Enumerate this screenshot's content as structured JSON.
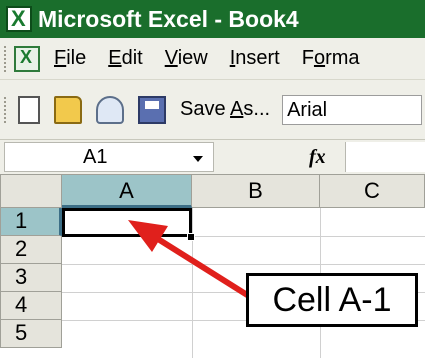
{
  "window": {
    "title": "Microsoft Excel - Book4"
  },
  "menu": {
    "items": [
      {
        "label_underlined": "F",
        "label_rest": "ile"
      },
      {
        "label_underlined": "E",
        "label_rest": "dit"
      },
      {
        "label_underlined": "V",
        "label_rest": "iew"
      },
      {
        "label_underlined": "I",
        "label_rest": "nsert"
      },
      {
        "label_underlined": "o",
        "label_prefix": "F",
        "label_rest": "rma"
      }
    ]
  },
  "toolbar": {
    "save_as_prefix": "Save ",
    "save_as_underlined": "A",
    "save_as_rest": "s...",
    "font_name": "Arial"
  },
  "formula_bar": {
    "name_box": "A1",
    "fx_label": "fx"
  },
  "grid": {
    "columns": [
      "A",
      "B",
      "C"
    ],
    "rows": [
      "1",
      "2",
      "3",
      "4",
      "5"
    ],
    "active_cell": "A1"
  },
  "annotation": {
    "callout_text": "Cell A-1",
    "arrow_color": "#e0201c"
  },
  "colors": {
    "title_bar": "#1a6e2c",
    "active_header": "#9cc4c8",
    "chrome": "#efefe8"
  }
}
